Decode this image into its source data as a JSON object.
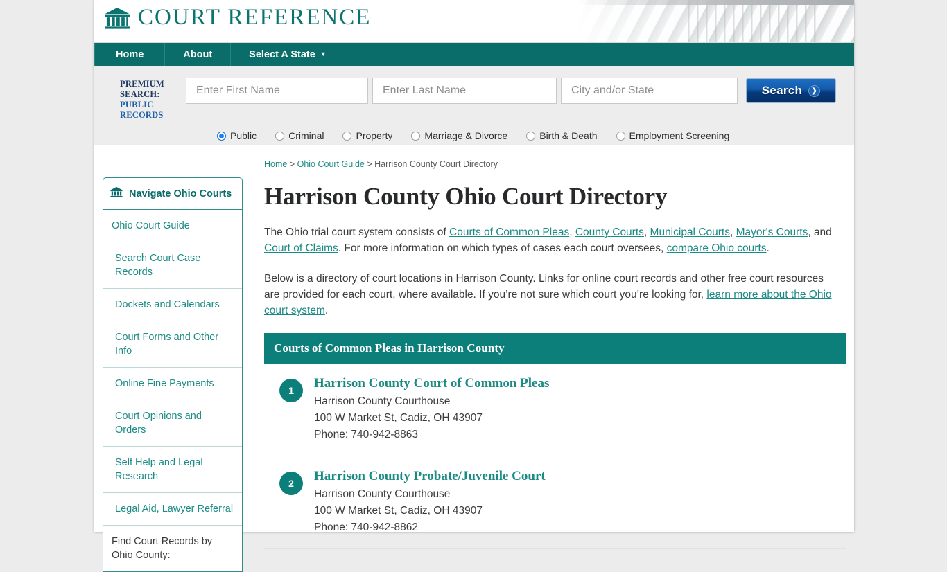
{
  "brand": {
    "name": "COURT REFERENCE",
    "icon": "courthouse-icon"
  },
  "nav": {
    "items": [
      {
        "label": "Home"
      },
      {
        "label": "About"
      },
      {
        "label": "Select A State",
        "caret": "▼"
      }
    ]
  },
  "search": {
    "label_line1": "PREMIUM",
    "label_line2": "SEARCH:",
    "label_line3": "PUBLIC",
    "label_line4": "RECORDS",
    "first_name_placeholder": "Enter First Name",
    "first_name_value": "",
    "last_name_placeholder": "Enter Last Name",
    "last_name_value": "",
    "city_state_placeholder": "City and/or State",
    "city_state_value": "",
    "button_label": "Search",
    "button_chevron": "❯",
    "options": [
      {
        "label": "Public",
        "selected": true
      },
      {
        "label": "Criminal",
        "selected": false
      },
      {
        "label": "Property",
        "selected": false
      },
      {
        "label": "Marriage & Divorce",
        "selected": false
      },
      {
        "label": "Birth & Death",
        "selected": false
      },
      {
        "label": "Employment Screening",
        "selected": false
      }
    ]
  },
  "sidebar": {
    "header": "Navigate Ohio Courts",
    "header_icon": "courthouse-icon",
    "items": [
      {
        "label": "Ohio Court Guide",
        "link": true
      },
      {
        "label": "Search Court Case Records",
        "link": true
      },
      {
        "label": "Dockets and Calendars",
        "link": true
      },
      {
        "label": "Court Forms and Other Info",
        "link": true
      },
      {
        "label": "Online Fine Payments",
        "link": true
      },
      {
        "label": "Court Opinions and Orders",
        "link": true
      },
      {
        "label": "Self Help and Legal Research",
        "link": true
      },
      {
        "label": "Legal Aid, Lawyer Referral",
        "link": true
      },
      {
        "label": "Find Court Records by Ohio County:",
        "link": false
      }
    ]
  },
  "breadcrumb": {
    "home": "Home",
    "sep1": " > ",
    "guide": "Ohio Court Guide",
    "sep2": " > ",
    "current": "Harrison County Court Directory"
  },
  "main": {
    "title": "Harrison County Ohio Court Directory",
    "p1": {
      "t1": "The Ohio trial court system consists of ",
      "a1": "Courts of Common Pleas",
      "t2": ", ",
      "a2": "County Courts",
      "t3": ", ",
      "a3": "Municipal Courts",
      "t4": ", ",
      "a4": "Mayor's Courts",
      "t5": ", and ",
      "a5": "Court of Claims",
      "t6": ". For more information on which types of cases each court oversees, ",
      "a6": "compare Ohio courts",
      "t7": "."
    },
    "p2": {
      "t1": "Below is a directory of court locations in Harrison County. Links for online court records and other free court resources are provided for each court, where available. If you’re not sure which court you’re looking for, ",
      "a1": "learn more about the Ohio court system",
      "t2": "."
    },
    "section_title": "Courts of Common Pleas in Harrison County",
    "courts": [
      {
        "number": "1",
        "name": "Harrison County Court of Common Pleas",
        "building": "Harrison County Courthouse",
        "address": "100 W Market St, Cadiz, OH 43907",
        "phone": "Phone: 740-942-8863"
      },
      {
        "number": "2",
        "name": "Harrison County Probate/Juvenile Court",
        "building": "Harrison County Courthouse",
        "address": "100 W Market St, Cadiz, OH 43907",
        "phone": "Phone: 740-942-8862"
      }
    ]
  },
  "colors": {
    "brand_teal": "#0b7470",
    "nav_teal": "#0b6d6a",
    "section_teal": "#0c7f7a",
    "link_teal": "#1a8a84",
    "search_blue": "#145bab",
    "page_bg": "#ececec"
  }
}
